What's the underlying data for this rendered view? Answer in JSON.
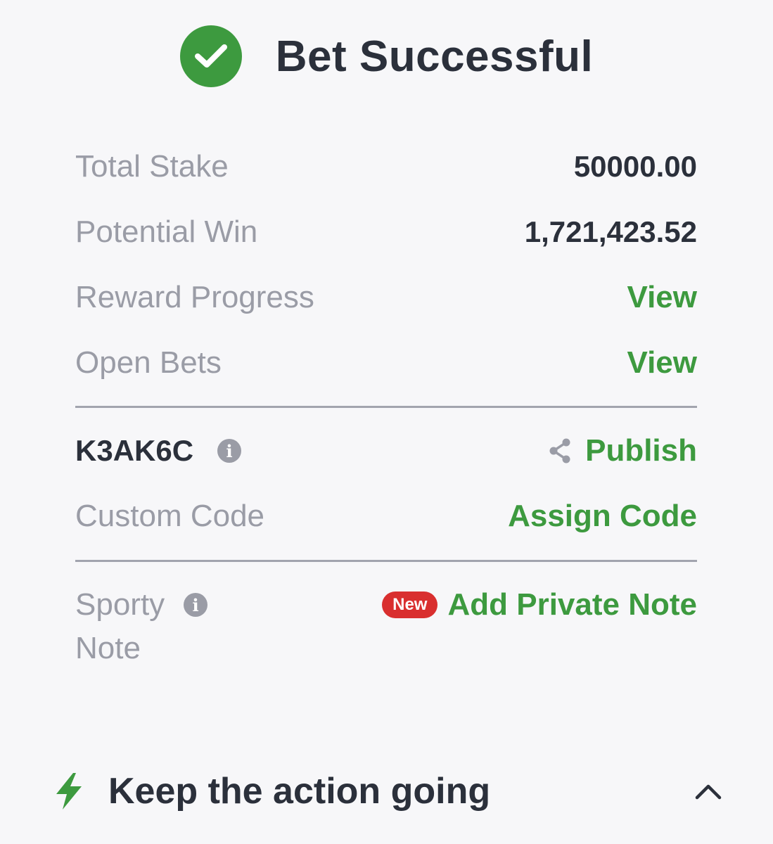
{
  "header": {
    "title": "Bet Successful",
    "icon": "check-circle-icon"
  },
  "summary": {
    "total_stake_label": "Total Stake",
    "total_stake_value": "50000.00",
    "potential_win_label": "Potential Win",
    "potential_win_value": "1,721,423.52",
    "reward_progress_label": "Reward Progress",
    "reward_progress_link": "View",
    "open_bets_label": "Open Bets",
    "open_bets_link": "View"
  },
  "booking": {
    "code": "K3AK6C",
    "info_glyph": "i",
    "publish_label": "Publish",
    "custom_code_label": "Custom Code",
    "assign_code_label": "Assign Code"
  },
  "note": {
    "label": "Sporty Note",
    "info_glyph": "i",
    "badge": "New",
    "add_label": "Add Private Note"
  },
  "footer": {
    "title": "Keep the action going",
    "icon": "lightning-icon"
  },
  "colors": {
    "accent_green": "#3d9a3f",
    "text_dark": "#2b303b",
    "text_muted": "#9a9ca6",
    "badge_red": "#d92f2f",
    "background": "#f7f7f9"
  }
}
